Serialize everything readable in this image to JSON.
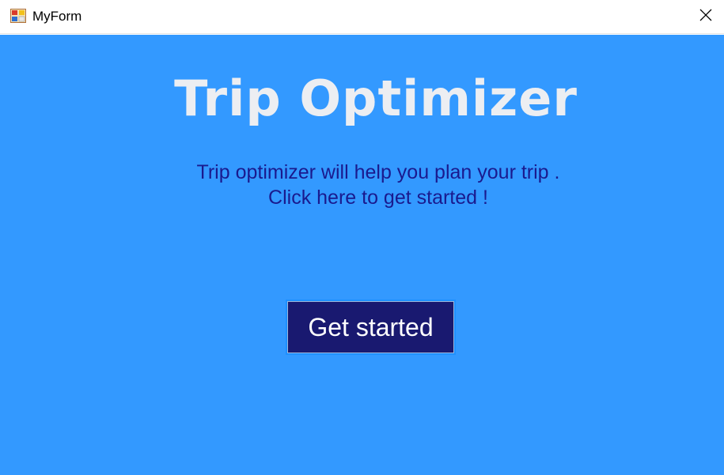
{
  "window": {
    "title": "MyForm",
    "icon": "form-app-icon",
    "close_icon": "close-icon"
  },
  "main": {
    "heading": "Trip Optimizer",
    "description_line1": "Trip optimizer will help you plan your trip .",
    "description_line2": "Click here to get started !",
    "button_label": "Get started"
  },
  "colors": {
    "background": "#3399ff",
    "heading": "#eceef2",
    "description": "#1a1a8e",
    "button_background": "#191970",
    "button_border": "#1e90ff",
    "button_text": "#ffffff"
  }
}
